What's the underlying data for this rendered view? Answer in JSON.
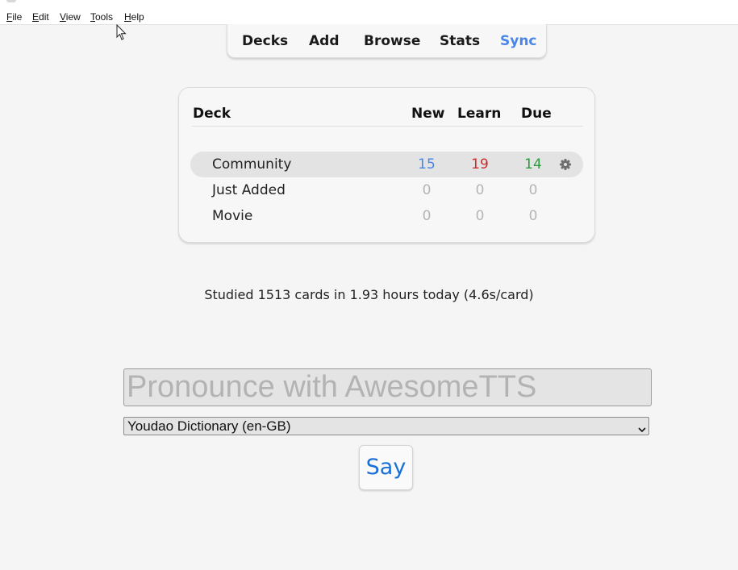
{
  "menubar": {
    "items": [
      {
        "label": "File",
        "mnemonic": "F",
        "rest": "ile"
      },
      {
        "label": "Edit",
        "mnemonic": "E",
        "rest": "dit"
      },
      {
        "label": "View",
        "mnemonic": "V",
        "rest": "iew"
      },
      {
        "label": "Tools",
        "mnemonic": "T",
        "rest": "ools"
      },
      {
        "label": "Help",
        "mnemonic": "H",
        "rest": "elp"
      }
    ]
  },
  "toolbar": {
    "links": [
      "Decks",
      "Add",
      "Browse",
      "Stats",
      "Sync"
    ],
    "sync_color": "#4a86e8"
  },
  "deck_table": {
    "headers": {
      "deck": "Deck",
      "new": "New",
      "learn": "Learn",
      "due": "Due"
    },
    "rows": [
      {
        "name": "Community",
        "new": "15",
        "learn": "19",
        "due": "14",
        "current": true
      },
      {
        "name": "Just Added",
        "new": "0",
        "learn": "0",
        "due": "0",
        "current": false
      },
      {
        "name": "Movie",
        "new": "0",
        "learn": "0",
        "due": "0",
        "current": false
      }
    ],
    "colors": {
      "new": "#4a86e8",
      "learn": "#cc2b2b",
      "due": "#2e9a3e",
      "zero": "#b5b5b5"
    },
    "options_icon": "gear-icon"
  },
  "stats": {
    "text": "Studied 1513 cards in 1.93 hours today (4.6s/card)"
  },
  "tts": {
    "placeholder": "Pronounce with AwesomeTTS",
    "value": "",
    "selected_voice": "Youdao Dictionary (en-GB)",
    "say_label": "Say"
  }
}
